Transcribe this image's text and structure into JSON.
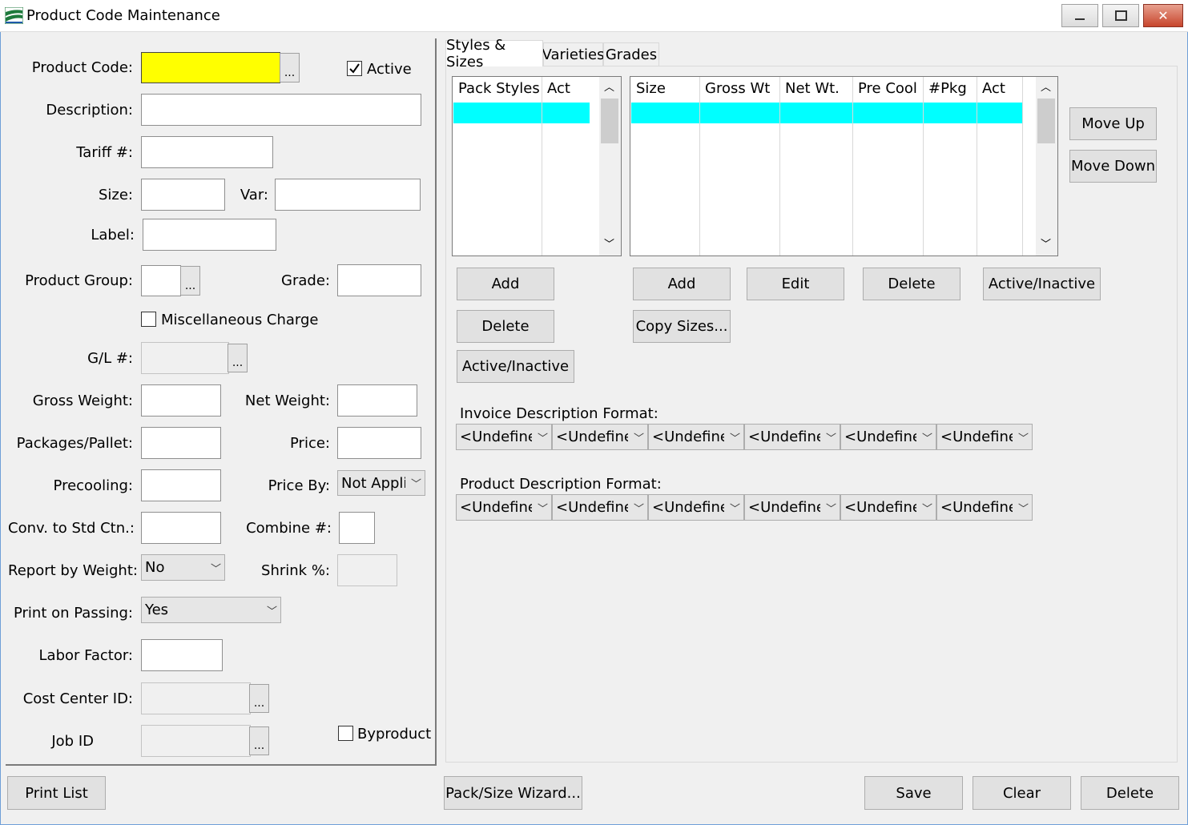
{
  "window": {
    "title": "Product Code Maintenance"
  },
  "left": {
    "product_code_label": "Product Code:",
    "product_code_value": "",
    "active_label": "Active",
    "active_checked": true,
    "description_label": "Description:",
    "tariff_label": "Tariff #:",
    "size_label": "Size:",
    "var_label": "Var:",
    "label_label": "Label:",
    "product_group_label": "Product Group:",
    "grade_label": "Grade:",
    "misc_charge_label": "Miscellaneous Charge",
    "gl_label": "G/L #:",
    "gross_weight_label": "Gross Weight:",
    "net_weight_label": "Net Weight:",
    "packages_pallet_label": "Packages/Pallet:",
    "price_label": "Price:",
    "precooling_label": "Precooling:",
    "price_by_label": "Price By:",
    "price_by_value": "Not Appli",
    "conv_label": "Conv. to Std Ctn.:",
    "combine_label": "Combine #:",
    "report_weight_label": "Report by Weight:",
    "report_weight_value": "No",
    "shrink_label": "Shrink %:",
    "print_passing_label": "Print on Passing:",
    "print_passing_value": "Yes",
    "labor_factor_label": "Labor Factor:",
    "cost_center_label": "Cost Center ID:",
    "job_id_label": "Job ID",
    "byproduct_label": "Byproduct",
    "ellipsis": "..."
  },
  "tabs": [
    "Styles & Sizes",
    "Varieties",
    "Grades"
  ],
  "pack_grid": {
    "columns": [
      "Pack Styles",
      "Act"
    ]
  },
  "size_grid": {
    "columns": [
      "Size",
      "Gross Wt",
      "Net Wt.",
      "Pre Cool",
      "#Pkg",
      "Act"
    ]
  },
  "buttons": {
    "move_up": "Move Up",
    "move_down": "Move Down",
    "pack_add": "Add",
    "pack_delete": "Delete",
    "pack_active": "Active/Inactive",
    "size_add": "Add",
    "size_edit": "Edit",
    "size_delete": "Delete",
    "size_active": "Active/Inactive",
    "copy_sizes": "Copy Sizes...",
    "print_list": "Print List",
    "wizard": "Pack/Size Wizard...",
    "save": "Save",
    "clear": "Clear",
    "delete": "Delete"
  },
  "invoice_format": {
    "label": "Invoice Description Format:",
    "options": [
      "<Undefined>",
      "<Undefined>",
      "<Undefined>",
      "<Undefined>",
      "<Undefined>",
      "<Undefined>"
    ]
  },
  "product_format": {
    "label": "Product Description Format:",
    "options": [
      "<Undefined>",
      "<Undefined>",
      "<Undefined>",
      "<Undefined>",
      "<Undefined>",
      "<Undefined>"
    ]
  },
  "colors": {
    "selection": "#00ffff",
    "required_field": "#ffff00"
  }
}
